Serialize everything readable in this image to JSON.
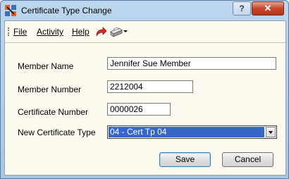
{
  "window": {
    "title": "Certificate Type Change",
    "help_label": "?",
    "close_label": "✕"
  },
  "menu": {
    "file": "File",
    "activity": "Activity",
    "help": "Help"
  },
  "form": {
    "member_name_label": "Member Name",
    "member_name_value": "Jennifer Sue Member",
    "member_number_label": "Member Number",
    "member_number_value": "2212004",
    "certificate_number_label": "Certificate Number",
    "certificate_number_value": "0000026",
    "new_cert_type_label": "New Certificate Type",
    "new_cert_type_value": "04 - Cert Tp 04"
  },
  "buttons": {
    "save": "Save",
    "cancel": "Cancel"
  }
}
